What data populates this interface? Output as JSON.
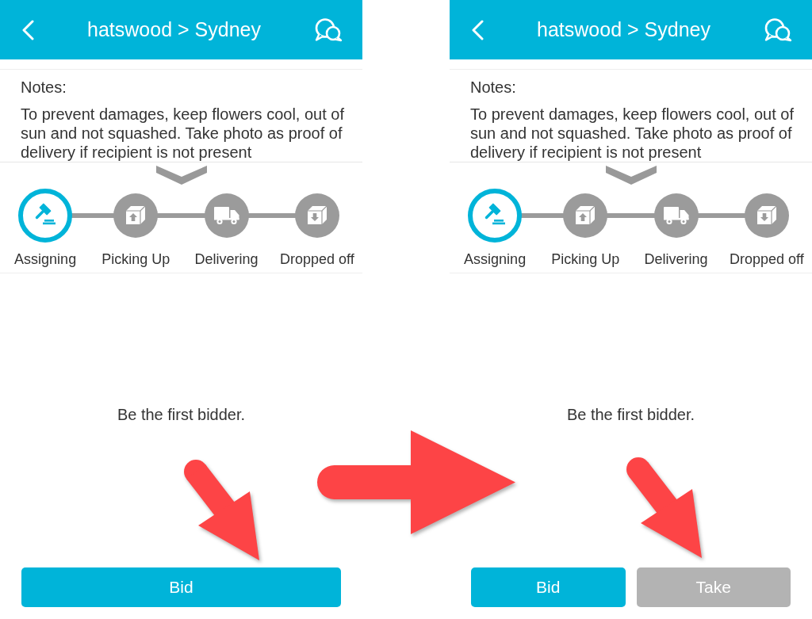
{
  "screens": [
    {
      "header": {
        "title": "hatswood > Sydney"
      },
      "notes": {
        "label": "Notes:",
        "lines": [
          "To prevent damages, keep flowers cool, out of",
          "sun and not squashed. Take photo as proof of",
          "delivery if recipient is not present"
        ]
      },
      "steps": [
        {
          "label": "Assigning",
          "active": true
        },
        {
          "label": "Picking Up",
          "active": false
        },
        {
          "label": "Delivering",
          "active": false
        },
        {
          "label": "Dropped off",
          "active": false
        }
      ],
      "message": "Be the first bidder.",
      "buttons": [
        {
          "label": "Bid",
          "disabled": false
        }
      ]
    },
    {
      "header": {
        "title": "hatswood > Sydney"
      },
      "notes": {
        "label": "Notes:",
        "lines": [
          "To prevent damages, keep flowers cool, out of",
          "sun and not squashed. Take photo as proof of",
          "delivery if recipient is not present"
        ]
      },
      "steps": [
        {
          "label": "Assigning",
          "active": true
        },
        {
          "label": "Picking Up",
          "active": false
        },
        {
          "label": "Delivering",
          "active": false
        },
        {
          "label": "Dropped off",
          "active": false
        }
      ],
      "message": "Be the first bidder.",
      "buttons": [
        {
          "label": "Bid",
          "disabled": false
        },
        {
          "label": "Take",
          "disabled": true
        }
      ]
    }
  ]
}
